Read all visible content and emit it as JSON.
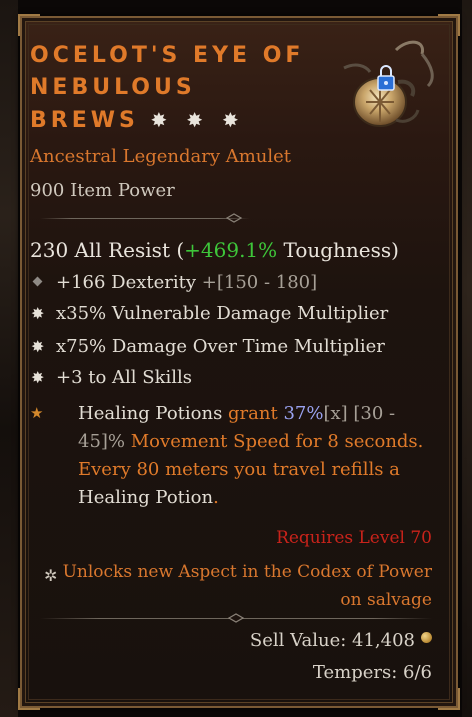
{
  "item": {
    "name_line1": "OCELOT'S EYE OF",
    "name_line2": "NEBULOUS",
    "name_line3": "BREWS",
    "name_stars": "✸ ✸ ✸",
    "type": "Ancestral Legendary Amulet",
    "item_power": "900 Item Power",
    "locked_icon": "lock-icon"
  },
  "resist": {
    "main": "230 All Resist (",
    "bonus": "+469.1%",
    "suffix": " Toughness)"
  },
  "affixes": [
    {
      "icon": "diamond-bullet-icon",
      "text": "+166 Dexterity ",
      "range": "+[150 - 180]"
    },
    {
      "icon": "greater-affix-star-icon",
      "text": "x35% Vulnerable Damage Multiplier",
      "range": ""
    },
    {
      "icon": "greater-affix-star-icon",
      "text": "x75% Damage Over Time Multiplier",
      "range": ""
    },
    {
      "icon": "greater-affix-star-icon",
      "text": "+3 to All Skills",
      "range": ""
    }
  ],
  "legendary": {
    "icon": "legendary-power-star-icon",
    "p1": "Healing Potions ",
    "p2": "grant ",
    "p3": "37%",
    "p4": "[x] [30 - 45]%",
    "p5": " Movement Speed for 8 seconds. Every 80 meters you travel refills a",
    "p6": " Healing Potion",
    "p7": "."
  },
  "requirements": "Requires Level 70",
  "unlock": {
    "icon": "codex-unlock-icon",
    "text": "Unlocks new Aspect in the Codex of Power on salvage"
  },
  "sell": {
    "label": "Sell Value: 41,408",
    "icon": "gold-coin-icon"
  },
  "tempers": "Tempers: 6/6",
  "colors": {
    "legendary_orange": "#e07a2a",
    "toughness_green": "#3ec63a",
    "requirement_red": "#c9231b",
    "value_purple": "#9aa2f0"
  }
}
